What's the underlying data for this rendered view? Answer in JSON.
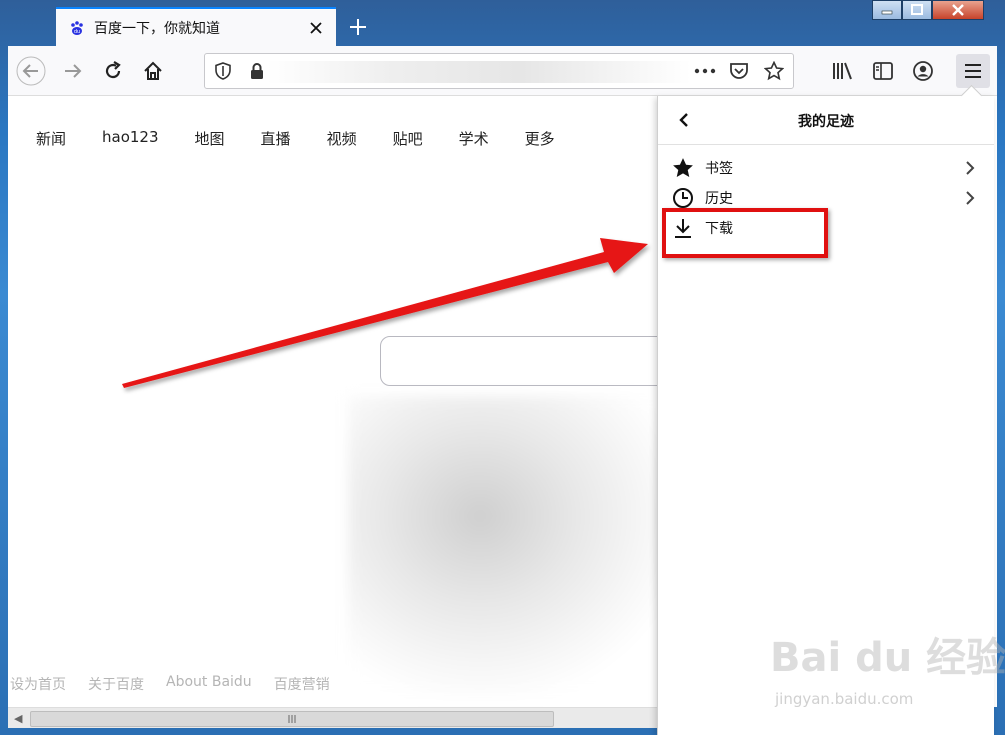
{
  "tab": {
    "title": "百度一下，你就知道"
  },
  "urlbar": {
    "value": ""
  },
  "page": {
    "nav_links": [
      "新闻",
      "hao123",
      "地图",
      "直播",
      "视频",
      "贴吧",
      "学术",
      "更多"
    ],
    "footer_links": [
      "设为首页",
      "关于百度",
      "About Baidu",
      "百度营销"
    ]
  },
  "menu": {
    "title": "我的足迹",
    "items": [
      {
        "label": "书签",
        "icon": "star-icon",
        "has_submenu": true
      },
      {
        "label": "历史",
        "icon": "clock-icon",
        "has_submenu": true
      },
      {
        "label": "下载",
        "icon": "download-icon",
        "has_submenu": false
      }
    ]
  },
  "watermark": {
    "main": "Bai du 经验",
    "sub": "jingyan.baidu.com"
  },
  "colors": {
    "accent": "#0a84ff",
    "highlight": "#e01010"
  }
}
